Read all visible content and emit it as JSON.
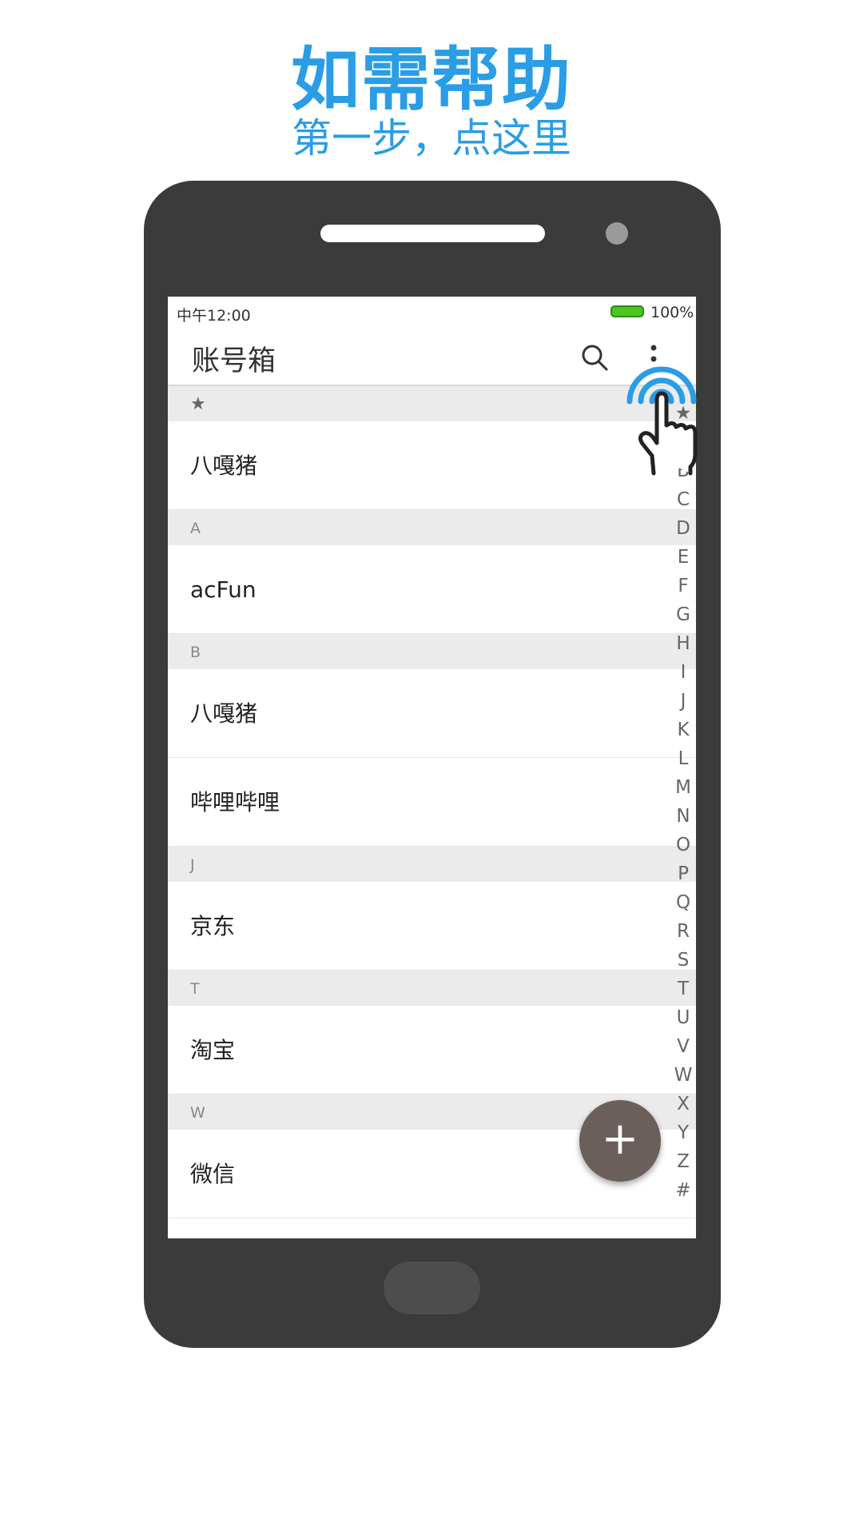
{
  "promo": {
    "headline": "如需帮助",
    "subline": "第一步，点这里"
  },
  "status_bar": {
    "time": "中午12:00",
    "battery": "100%",
    "battery_color": "#4ac61d"
  },
  "app_bar": {
    "title": "账号箱",
    "search_icon": "search-icon",
    "more_icon": "more-vertical-icon"
  },
  "list": {
    "sections": [
      {
        "header": "★",
        "items": [
          "八嘎猪"
        ]
      },
      {
        "header": "A",
        "items": [
          "acFun"
        ]
      },
      {
        "header": "B",
        "items": [
          "八嘎猪",
          "哔哩哔哩"
        ]
      },
      {
        "header": "J",
        "items": [
          "京东"
        ]
      },
      {
        "header": "T",
        "items": [
          "淘宝"
        ]
      },
      {
        "header": "W",
        "items": [
          "微信"
        ]
      }
    ]
  },
  "index_bar": [
    "★",
    "A",
    "B",
    "C",
    "D",
    "E",
    "F",
    "G",
    "H",
    "I",
    "J",
    "K",
    "L",
    "M",
    "N",
    "O",
    "P",
    "Q",
    "R",
    "S",
    "T",
    "U",
    "V",
    "W",
    "X",
    "Y",
    "Z",
    "#"
  ],
  "fab": {
    "label": "+",
    "color": "#6a5f5a"
  },
  "accent_color": "#2a9de6"
}
